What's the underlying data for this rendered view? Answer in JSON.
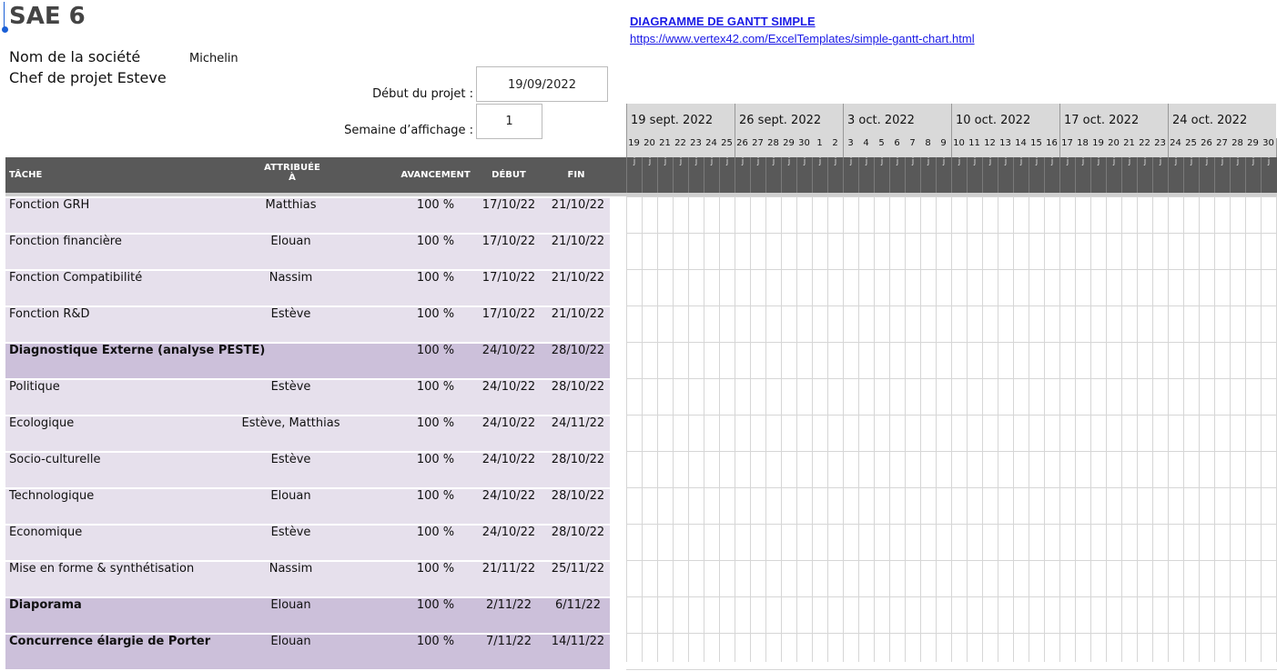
{
  "sheet": {
    "title": "SAE 6",
    "company_label": "Nom de la société",
    "company_value": "Michelin",
    "manager_text": "Chef de projet Esteve",
    "gantt_title_link": "DIAGRAMME DE GANTT SIMPLE ",
    "template_url_link": "https://www.vertex42.com/ExcelTemplates/simple-gantt-chart.html",
    "project_start_label": "Début du projet :",
    "project_start_value": "19/09/2022",
    "display_week_label": "Semaine d’affichage :",
    "display_week_value": "1"
  },
  "columns": {
    "task": "TÂCHE",
    "assigned_line1": "ATTRIBUÉE",
    "assigned_line2": "À",
    "progress": "AVANCEMENT",
    "start": "DÉBUT",
    "end": "FIN"
  },
  "timeline": {
    "weeks": [
      "19 sept. 2022",
      "26 sept. 2022",
      "3 oct. 2022",
      "10 oct. 2022",
      "17 oct. 2022",
      "24 oct. 2022"
    ],
    "days": [
      "19",
      "20",
      "21",
      "22",
      "23",
      "24",
      "25",
      "26",
      "27",
      "28",
      "29",
      "30",
      "1",
      "2",
      "3",
      "4",
      "5",
      "6",
      "7",
      "8",
      "9",
      "10",
      "11",
      "12",
      "13",
      "14",
      "15",
      "16",
      "17",
      "18",
      "19",
      "20",
      "21",
      "22",
      "23",
      "24",
      "25",
      "26",
      "27",
      "28",
      "29",
      "30"
    ],
    "day_letter": "j"
  },
  "tasks": [
    {
      "name": "Fonction GRH",
      "assignee": "Matthias",
      "progress": "100 %",
      "start": "17/10/22",
      "end": "21/10/22",
      "phase": false
    },
    {
      "name": "Fonction financière",
      "assignee": "Elouan",
      "progress": "100 %",
      "start": "17/10/22",
      "end": "21/10/22",
      "phase": false
    },
    {
      "name": "Fonction Compatibilité",
      "assignee": "Nassim",
      "progress": "100 %",
      "start": "17/10/22",
      "end": "21/10/22",
      "phase": false
    },
    {
      "name": "Fonction R&D",
      "assignee": "Estève",
      "progress": "100 %",
      "start": "17/10/22",
      "end": "21/10/22",
      "phase": false
    },
    {
      "name": "Diagnostique Externe (analyse PESTE)",
      "assignee": "",
      "progress": "100 %",
      "start": "24/10/22",
      "end": "28/10/22",
      "phase": true
    },
    {
      "name": "Politique",
      "assignee": "Estève",
      "progress": "100 %",
      "start": "24/10/22",
      "end": "28/10/22",
      "phase": false
    },
    {
      "name": "Ecologique",
      "assignee": "Estève, Matthias",
      "progress": "100 %",
      "start": "24/10/22",
      "end": "24/11/22",
      "phase": false
    },
    {
      "name": "Socio-culturelle",
      "assignee": "Estève",
      "progress": "100 %",
      "start": "24/10/22",
      "end": "28/10/22",
      "phase": false
    },
    {
      "name": "Technologique",
      "assignee": "Elouan",
      "progress": "100 %",
      "start": "24/10/22",
      "end": "28/10/22",
      "phase": false
    },
    {
      "name": "Economique",
      "assignee": "Estève",
      "progress": "100 %",
      "start": "24/10/22",
      "end": "28/10/22",
      "phase": false
    },
    {
      "name": "Mise en forme & synthétisation",
      "assignee": "Nassim",
      "progress": "100 %",
      "start": "21/11/22",
      "end": "25/11/22",
      "phase": false
    },
    {
      "name": "Diaporama",
      "assignee": "Elouan",
      "progress": "100 %",
      "start": "2/11/22",
      "end": "6/11/22",
      "phase": true
    },
    {
      "name": "Concurrence élargie de Porter",
      "assignee": "Elouan",
      "progress": "100 %",
      "start": "7/11/22",
      "end": "14/11/22",
      "phase": true
    }
  ],
  "colors": {
    "task_row_bg": "#e6e0ec",
    "phase_row_bg": "#ccc0da",
    "header_bg": "#595959",
    "timeline_header_bg": "#d9d9d9",
    "link": "#1a1ae6"
  }
}
